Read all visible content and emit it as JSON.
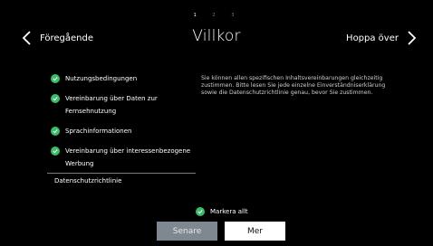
{
  "steps": {
    "items": [
      "1",
      "2",
      "3"
    ],
    "active": 0
  },
  "header": {
    "prev_label": "Föregående",
    "title": "Villkor",
    "next_label": "Hoppa över"
  },
  "agreements": [
    {
      "label": "Nutzungsbedingungen",
      "checked": true
    },
    {
      "label": "Vereinbarung über Daten zur Fernsehnutzung",
      "checked": true
    },
    {
      "label": "Sprachinformationen",
      "checked": true
    },
    {
      "label": "Vereinbarung über interessenbezogene Werbung",
      "checked": true
    }
  ],
  "privacy_policy_label": "Datenschutzrichtlinie",
  "description": "Sie können allen spezifischen Inhaltsvereinbarungen gleichzeitig zustimmen. Bitte lesen Sie jede einzelne Einverständniserklärung sowie die Datenschutzrichtlinie genau, bevor Sie zustimmen.",
  "select_all": {
    "label": "Markera allt",
    "checked": true
  },
  "buttons": {
    "later": "Senare",
    "more": "Mer"
  },
  "colors": {
    "check": "#3dbb6a",
    "later_button": "#7f8790",
    "more_button": "#ffffff"
  }
}
